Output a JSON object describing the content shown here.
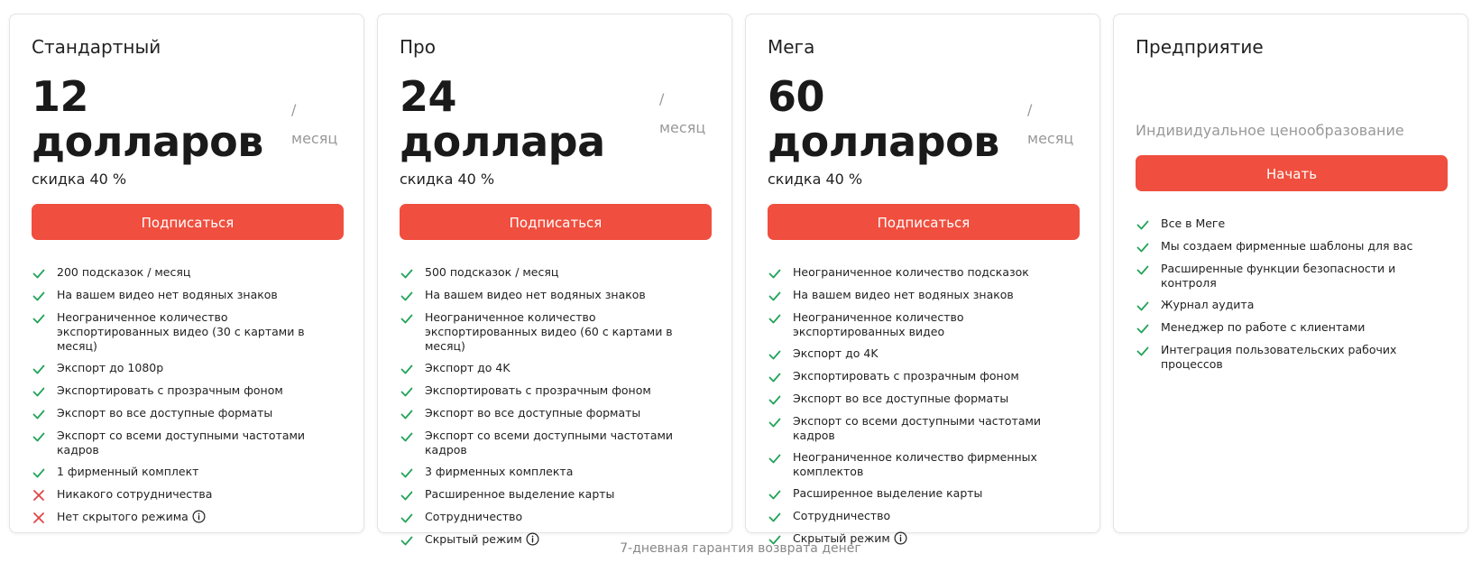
{
  "colors": {
    "accent": "#f04e3e",
    "check": "#22a35a",
    "cross": "#e04545",
    "muted": "#999999"
  },
  "plans": [
    {
      "name": "Стандартный",
      "price": "12 долларов",
      "per": "/ месяц",
      "discount": "скидка 40 %",
      "cta": "Подписаться",
      "features": [
        {
          "text": "200 подсказок / месяц",
          "ok": true
        },
        {
          "text": "На вашем видео нет водяных знаков",
          "ok": true
        },
        {
          "text": "Неограниченное количество экспортированных видео (30 с картами в месяц)",
          "ok": true
        },
        {
          "text": "Экспорт до 1080p",
          "ok": true
        },
        {
          "text": "Экспортировать с прозрачным фоном",
          "ok": true
        },
        {
          "text": "Экспорт во все доступные форматы",
          "ok": true
        },
        {
          "text": "Экспорт со всеми доступными частотами кадров",
          "ok": true
        },
        {
          "text": "1 фирменный комплект",
          "ok": true
        },
        {
          "text": "Никакого сотрудничества",
          "ok": false
        },
        {
          "text": "Нет скрытого режима",
          "ok": false,
          "info": true
        }
      ]
    },
    {
      "name": "Про",
      "price": "24 доллара",
      "per": "/ месяц",
      "discount": "скидка 40 %",
      "cta": "Подписаться",
      "features": [
        {
          "text": "500 подсказок / месяц",
          "ok": true
        },
        {
          "text": "На вашем видео нет водяных знаков",
          "ok": true
        },
        {
          "text": "Неограниченное количество экспортированных видео (60 с картами в месяц)",
          "ok": true
        },
        {
          "text": "Экспорт до 4K",
          "ok": true
        },
        {
          "text": "Экспортировать с прозрачным фоном",
          "ok": true
        },
        {
          "text": "Экспорт во все доступные форматы",
          "ok": true
        },
        {
          "text": "Экспорт со всеми доступными частотами кадров",
          "ok": true
        },
        {
          "text": "3 фирменных комплекта",
          "ok": true
        },
        {
          "text": "Расширенное выделение карты",
          "ok": true
        },
        {
          "text": "Сотрудничество",
          "ok": true
        },
        {
          "text": "Скрытый режим",
          "ok": true,
          "info": true
        }
      ]
    },
    {
      "name": "Мега",
      "price": "60 долларов",
      "per": "/ месяц",
      "discount": "скидка 40 %",
      "cta": "Подписаться",
      "features": [
        {
          "text": "Неограниченное количество подсказок",
          "ok": true
        },
        {
          "text": "На вашем видео нет водяных знаков",
          "ok": true
        },
        {
          "text": "Неограниченное количество экспортированных видео",
          "ok": true
        },
        {
          "text": "Экспорт до 4K",
          "ok": true
        },
        {
          "text": "Экспортировать с прозрачным фоном",
          "ok": true
        },
        {
          "text": "Экспорт во все доступные форматы",
          "ok": true
        },
        {
          "text": "Экспорт со всеми доступными частотами кадров",
          "ok": true
        },
        {
          "text": "Неограниченное количество фирменных комплектов",
          "ok": true
        },
        {
          "text": "Расширенное выделение карты",
          "ok": true
        },
        {
          "text": "Сотрудничество",
          "ok": true
        },
        {
          "text": "Скрытый режим",
          "ok": true,
          "info": true
        }
      ]
    },
    {
      "name": "Предприятие",
      "note": "Индивидуальное ценообразование",
      "cta": "Начать",
      "features": [
        {
          "text": "Все в Меге",
          "ok": true
        },
        {
          "text": "Мы создаем фирменные шаблоны для вас",
          "ok": true
        },
        {
          "text": "Расширенные функции безопасности и контроля",
          "ok": true
        },
        {
          "text": "Журнал аудита",
          "ok": true
        },
        {
          "text": "Менеджер по работе с клиентами",
          "ok": true
        },
        {
          "text": "Интеграция пользовательских рабочих процессов",
          "ok": true
        }
      ]
    }
  ],
  "footer": "7-дневная гарантия возврата денег"
}
